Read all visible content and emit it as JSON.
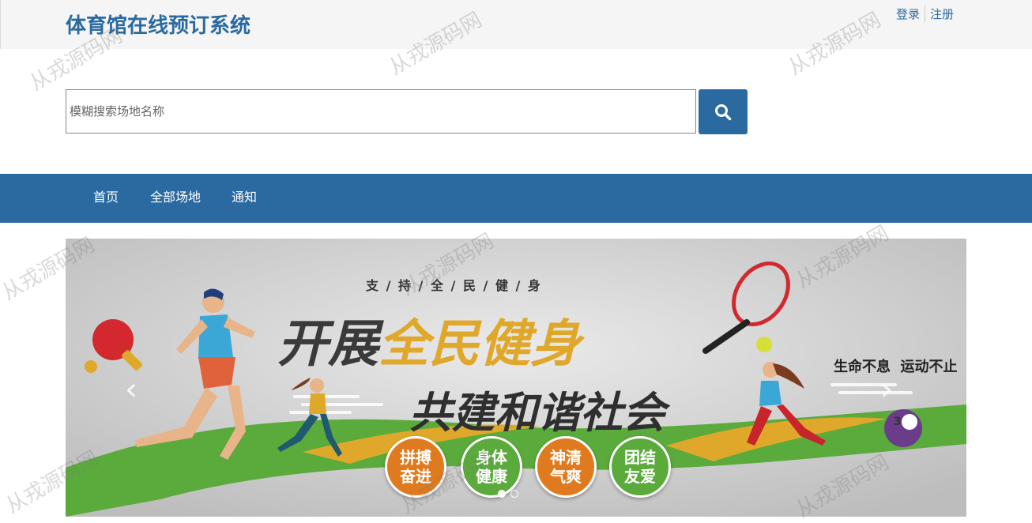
{
  "header": {
    "title": "体育馆在线预订系统",
    "login": "登录",
    "register": "注册"
  },
  "search": {
    "placeholder": "模糊搜索场地名称",
    "button_icon": "search-icon"
  },
  "nav": {
    "items": [
      "首页",
      "全部场地",
      "通知"
    ]
  },
  "banner": {
    "top_text": "支 / 持 / 全 / 民 / 健 / 身",
    "headline_dark": "开展",
    "headline_gold": "全民健身",
    "subheadline": "共建和谐社会",
    "slogan": "生命不息  运动不止",
    "badges": [
      {
        "line1": "拼搏",
        "line2": "奋进"
      },
      {
        "line1": "身体",
        "line2": "健康"
      },
      {
        "line1": "神清",
        "line2": "气爽"
      },
      {
        "line1": "团结",
        "line2": "友爱"
      }
    ],
    "ball_number": "3",
    "slide_count": 2,
    "active_slide": 1
  },
  "watermark": "从戎源码网",
  "colors": {
    "primary": "#2a6aa0",
    "gold": "#e0a82a",
    "green": "#5aab3c",
    "orange": "#e07a1e"
  }
}
